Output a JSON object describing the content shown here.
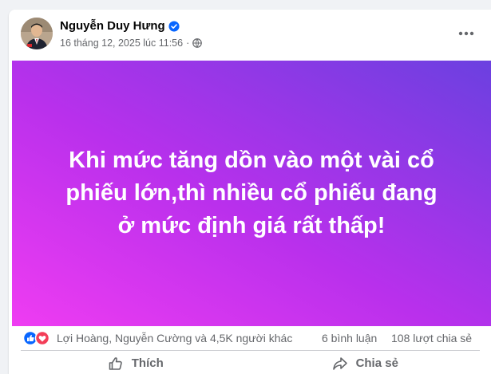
{
  "post": {
    "author": "Nguyễn Duy Hưng",
    "timestamp": "16 tháng 12, 2025 lúc 11:56",
    "privacy_icon": "globe-icon",
    "verified_icon": "verified-badge-icon",
    "more_icon": "more-options-icon",
    "image_text": "Khi mức tăng dồn vào một vài cổ phiếu lớn,thì nhiều cổ phiếu đang ở mức định giá rất thấp!"
  },
  "stats": {
    "reactions_text": "Lợi Hoàng, Nguyễn Cường và 4,5K người khác",
    "comments": "6 bình luận",
    "shares": "108 lượt chia sẻ"
  },
  "actions": {
    "like_label": "Thích",
    "share_label": "Chia sẻ"
  },
  "colors": {
    "like_blue": "#0866ff",
    "love_red": "#f33e58",
    "gradient_start": "#ef3cf2",
    "gradient_end": "#6b40e0",
    "secondary_text": "#65676b"
  }
}
